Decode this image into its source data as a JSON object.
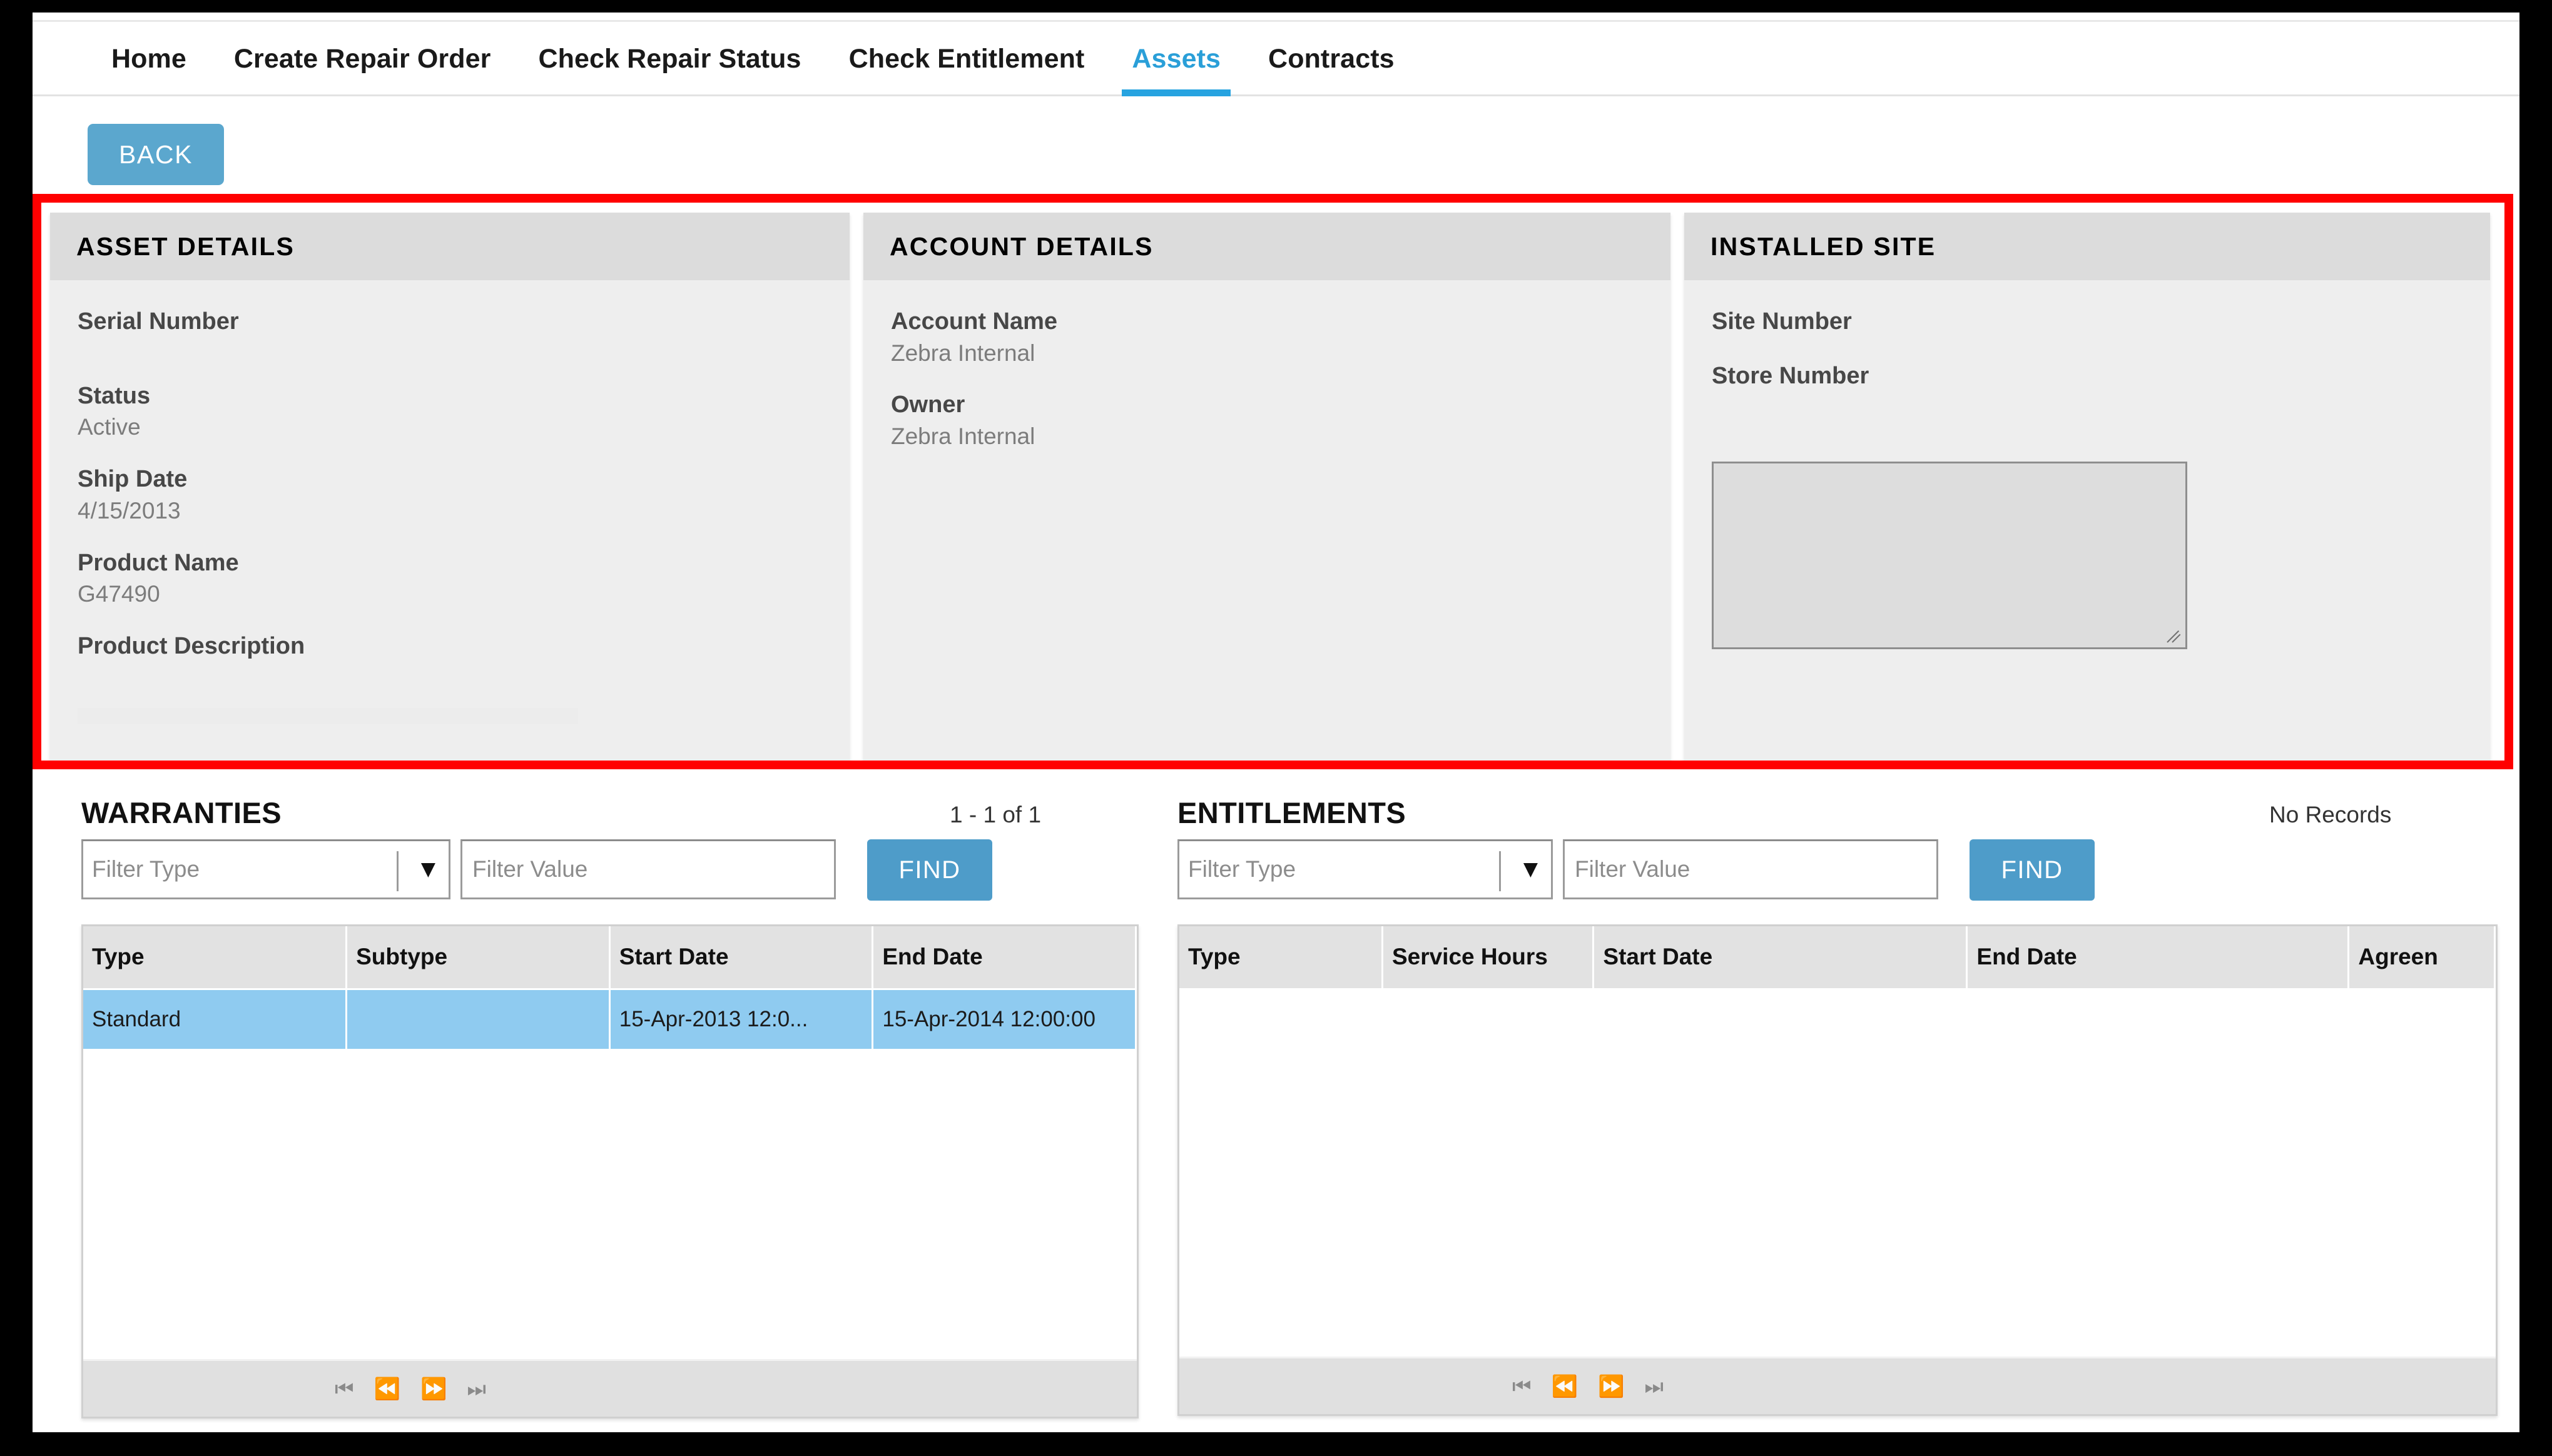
{
  "nav": {
    "items": [
      {
        "label": "Home",
        "active": false
      },
      {
        "label": "Create Repair Order",
        "active": false
      },
      {
        "label": "Check Repair Status",
        "active": false
      },
      {
        "label": "Check Entitlement",
        "active": false
      },
      {
        "label": "Assets",
        "active": true
      },
      {
        "label": "Contracts",
        "active": false
      }
    ],
    "accent_color": "#27a3e0"
  },
  "toolbar": {
    "back_label": "BACK",
    "back_color": "#5ba7ce"
  },
  "highlight": {
    "color": "#ff0000"
  },
  "asset_details": {
    "title": "ASSET DETAILS",
    "fields": [
      {
        "label": "Serial Number",
        "value": ""
      },
      {
        "label": "Status",
        "value": "Active"
      },
      {
        "label": "Ship Date",
        "value": "4/15/2013"
      },
      {
        "label": "Product Name",
        "value": "G47490"
      },
      {
        "label": "Product Description",
        "value": ""
      }
    ]
  },
  "account_details": {
    "title": "ACCOUNT DETAILS",
    "fields": [
      {
        "label": "Account Name",
        "value": "Zebra Internal"
      },
      {
        "label": "Owner",
        "value": "Zebra Internal"
      }
    ]
  },
  "installed_site": {
    "title": "INSTALLED SITE",
    "fields": [
      {
        "label": "Site Number",
        "value": ""
      },
      {
        "label": "Store Number",
        "value": ""
      }
    ],
    "textarea_value": ""
  },
  "warranties": {
    "title": "WARRANTIES",
    "record_count": "1 - 1 of 1",
    "filter": {
      "type_placeholder": "Filter Type",
      "value_placeholder": "Filter Value",
      "find_label": "FIND"
    },
    "columns": [
      "Type",
      "Subtype",
      "Start Date",
      "End Date"
    ],
    "rows": [
      {
        "selected": true,
        "cells": [
          "Standard",
          "",
          "15-Apr-2013 12:0...",
          "15-Apr-2014 12:00:00"
        ]
      }
    ],
    "pager": [
      "first-page-icon",
      "prev-page-icon",
      "next-page-icon",
      "last-page-icon"
    ],
    "pager_glyphs": [
      "⏮",
      "⏪",
      "⏩",
      "⏭"
    ]
  },
  "entitlements": {
    "title": "ENTITLEMENTS",
    "record_count": "No Records",
    "filter": {
      "type_placeholder": "Filter Type",
      "value_placeholder": "Filter Value",
      "find_label": "FIND"
    },
    "columns": [
      "Type",
      "Service Hours",
      "Start Date",
      "End Date",
      "Agreen"
    ],
    "rows": [],
    "pager": [
      "first-page-icon",
      "prev-page-icon",
      "next-page-icon",
      "last-page-icon"
    ],
    "pager_glyphs": [
      "⏮",
      "⏪",
      "⏩",
      "⏭"
    ]
  },
  "icons": {
    "dropdown_arrow": "⌄"
  }
}
